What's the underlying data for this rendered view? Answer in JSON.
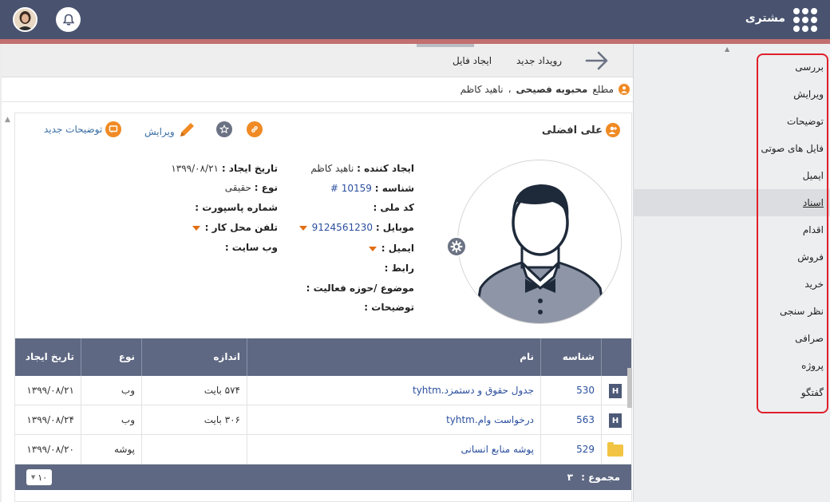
{
  "header": {
    "app_title": "مشتری",
    "grid_icon": "apps-grid-icon",
    "bell_icon": "bell-icon",
    "avatar": "user-avatar"
  },
  "toolbar": {
    "back_icon": "arrow-right-icon",
    "new_event": "رویداد جدید",
    "create_file": "ایجاد فایل"
  },
  "breadcrumb": {
    "label": "مطلع",
    "primary": "محبوبه فصیحی",
    "separator": "،",
    "secondary": "ناهید کاظم"
  },
  "record": {
    "name": "علی افضلی",
    "actions": {
      "edit": "ویرایش",
      "new_notes": "توضیحات جدید"
    }
  },
  "fields": {
    "created_by_label": "ایجاد کننده :",
    "created_by_value": "ناهید کاظم",
    "id_label": "شناسه :",
    "id_value": "# 10159",
    "national_code_label": "کد ملی :",
    "mobile_label": "موبایل :",
    "mobile_value": "9124561230",
    "email_label": "ایمیل :",
    "contact_label": "رابط :",
    "activity_label": "موضوع /حوزه فعالیت :",
    "notes_label": "توضیحات :",
    "created_date_label": "تاریخ ایجاد :",
    "created_date_value": "۱۳۹۹/۰۸/۲۱",
    "type_label": "نوع :",
    "type_value": "حقیقی",
    "passport_label": "شماره پاسپورت :",
    "work_phone_label": "تلفن محل کار :",
    "website_label": "وب سایت :"
  },
  "table": {
    "columns": [
      "شناسه",
      "نام",
      "اندازه",
      "نوع",
      "تاریخ ایجاد"
    ],
    "rows": [
      {
        "icon": "html-file-icon",
        "id": "530",
        "name": "جدول حقوق و دستمزد.tyhtm",
        "size": "۵۷۴ بایت",
        "type": "وب",
        "date": "۱۳۹۹/۰۸/۲۱"
      },
      {
        "icon": "html-file-icon",
        "id": "563",
        "name": "درخواست وام.tyhtm",
        "size": "۳۰۶ بایت",
        "type": "وب",
        "date": "۱۳۹۹/۰۸/۲۴"
      },
      {
        "icon": "folder-icon",
        "id": "529",
        "name": "پوشه منابع انسانی",
        "size": "",
        "type": "پوشه",
        "date": "۱۳۹۹/۰۸/۲۰"
      }
    ],
    "total_label": "مجموع :",
    "total_value": "۳",
    "page_size": "۱۰"
  },
  "sidebar": {
    "items": [
      {
        "label": "بررسی",
        "active": false
      },
      {
        "label": "ویرایش",
        "active": false
      },
      {
        "label": "توضیحات",
        "active": false
      },
      {
        "label": "فایل های صوتی",
        "active": false
      },
      {
        "label": "ایمیل",
        "active": false
      },
      {
        "label": "اسناد",
        "active": true
      },
      {
        "label": "اقدام",
        "active": false
      },
      {
        "label": "فروش",
        "active": false
      },
      {
        "label": "خرید",
        "active": false
      },
      {
        "label": "نظر سنجی",
        "active": false
      },
      {
        "label": "صرافی",
        "active": false
      },
      {
        "label": "پروژه",
        "active": false
      },
      {
        "label": "گفتگو",
        "active": false
      }
    ]
  },
  "colors": {
    "header_bg": "#495370",
    "accent_orange": "#f08a24",
    "table_header": "#5e6882",
    "highlight_border": "#e0202b"
  }
}
